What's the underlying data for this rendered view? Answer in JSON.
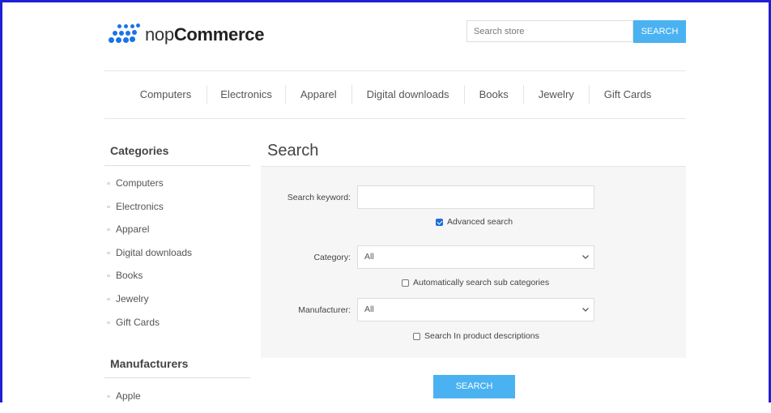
{
  "header": {
    "logo_plain": "nop",
    "logo_bold": "Commerce",
    "search_placeholder": "Search store",
    "search_button": "SEARCH"
  },
  "nav": [
    "Computers",
    "Electronics",
    "Apparel",
    "Digital downloads",
    "Books",
    "Jewelry",
    "Gift Cards"
  ],
  "sidebar": {
    "categories_title": "Categories",
    "categories": [
      "Computers",
      "Electronics",
      "Apparel",
      "Digital downloads",
      "Books",
      "Jewelry",
      "Gift Cards"
    ],
    "manufacturers_title": "Manufacturers",
    "manufacturers": [
      "Apple"
    ]
  },
  "main": {
    "title": "Search",
    "keyword_label": "Search keyword:",
    "keyword_value": "",
    "advanced_search": {
      "label": "Advanced search",
      "checked": true
    },
    "category_label": "Category:",
    "category_value": "All",
    "sub_categories": {
      "label": "Automatically search sub categories",
      "checked": false
    },
    "manufacturer_label": "Manufacturer:",
    "manufacturer_value": "All",
    "product_descriptions": {
      "label": "Search In product descriptions",
      "checked": false
    },
    "search_button": "SEARCH"
  },
  "colors": {
    "accent": "#4ab2f1",
    "frame": "#1f1fd6",
    "logo": "#1a73e8"
  },
  "icons": [
    "logo-dots-icon",
    "chevron-down-icon",
    "checkbox-icon"
  ]
}
